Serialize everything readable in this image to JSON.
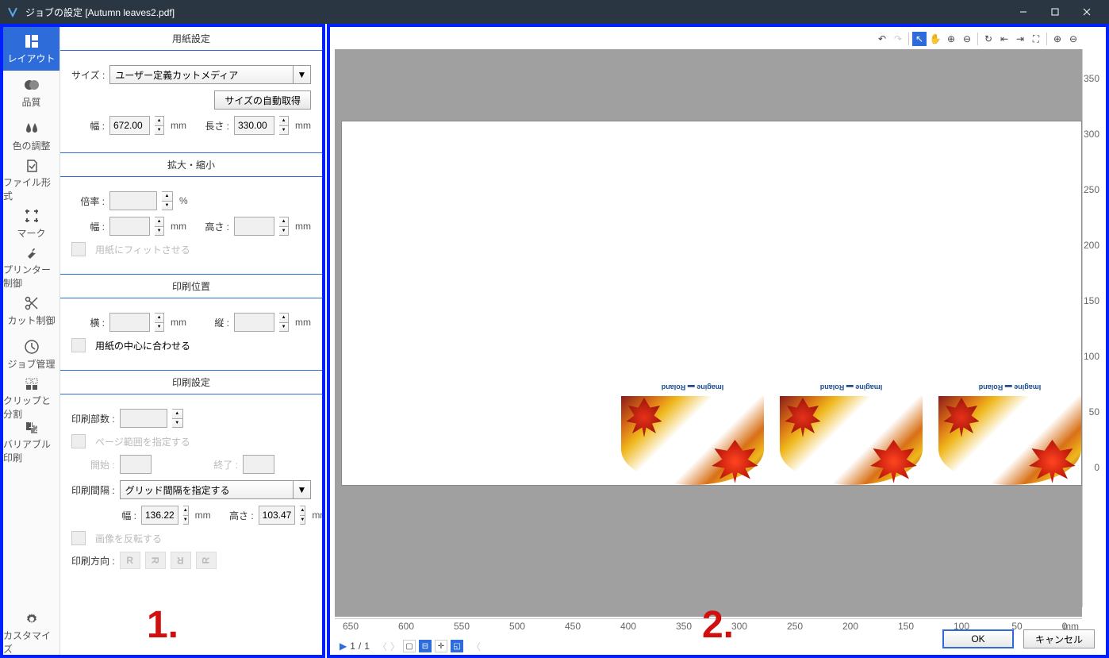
{
  "titlebar": {
    "app": "V",
    "title": "ジョブの設定 [Autumn leaves2.pdf]"
  },
  "sidebar": {
    "items": [
      {
        "label": "レイアウト"
      },
      {
        "label": "品質"
      },
      {
        "label": "色の調整"
      },
      {
        "label": "ファイル形式"
      },
      {
        "label": "マーク"
      },
      {
        "label": "プリンター制御"
      },
      {
        "label": "カット制御"
      },
      {
        "label": "ジョブ管理"
      },
      {
        "label": "クリップと分割"
      },
      {
        "label": "バリアブル 印刷"
      }
    ],
    "customize": "カスタマイズ"
  },
  "sections": {
    "paper": {
      "title": "用紙設定",
      "size_label": "サイズ :",
      "size_value": "ユーザー定義カットメディア",
      "auto_btn": "サイズの自動取得",
      "width_label": "幅 :",
      "width_value": "672.00",
      "length_label": "長さ :",
      "length_value": "330.00",
      "unit": "mm"
    },
    "scale": {
      "title": "拡大・縮小",
      "ratio_label": "倍率 :",
      "ratio_unit": "%",
      "width_label": "幅 :",
      "height_label": "高さ :",
      "unit": "mm",
      "fit_label": "用紙にフィットさせる"
    },
    "position": {
      "title": "印刷位置",
      "h_label": "横 :",
      "v_label": "縦 :",
      "unit": "mm",
      "center_label": "用紙の中心に合わせる"
    },
    "print": {
      "title": "印刷設定",
      "copies_label": "印刷部数 :",
      "range_label": "ページ範囲を指定する",
      "start_label": "開始 :",
      "end_label": "終了 :",
      "gap_label": "印刷間隔 :",
      "gap_value": "グリッド間隔を指定する",
      "gap_width_label": "幅 :",
      "gap_width_value": "136.22",
      "gap_height_label": "高さ :",
      "gap_height_value": "103.47",
      "unit": "mm",
      "flip_label": "画像を反転する",
      "direction_label": "印刷方向 :",
      "dir_r": "R"
    }
  },
  "preview": {
    "page_current": "1",
    "page_sep": "/",
    "page_total": "1",
    "ruler_h": [
      "650",
      "600",
      "550",
      "500",
      "450",
      "400",
      "350",
      "300",
      "250",
      "200",
      "150",
      "100",
      "50",
      "0"
    ],
    "ruler_h_unit": "mm",
    "ruler_v": [
      "350",
      "300",
      "250",
      "200",
      "150",
      "100",
      "50",
      "0"
    ],
    "thumb_logo": "Imagine ▬ Roland"
  },
  "footer": {
    "ok": "OK",
    "cancel": "キャンセル"
  },
  "annotations": {
    "one": "1.",
    "two": "2."
  }
}
